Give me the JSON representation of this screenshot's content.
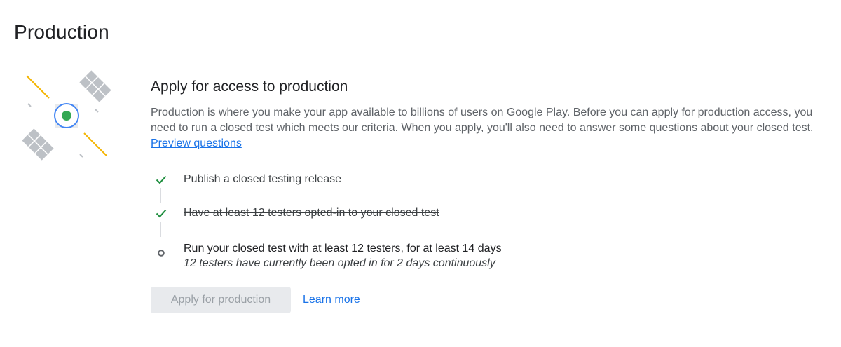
{
  "page": {
    "title": "Production"
  },
  "section": {
    "title": "Apply for access to production",
    "description": "Production is where you make your app available to billions of users on Google Play. Before you can apply for production access, you need to run a closed test which meets our criteria. When you apply, you'll also need to answer some questions about your closed test.",
    "preview_link": "Preview questions"
  },
  "checklist": [
    {
      "label": "Publish a closed testing release",
      "status": "done",
      "icon": "check-icon"
    },
    {
      "label": "Have at least 12 testers opted-in to your closed test",
      "status": "done",
      "icon": "check-icon"
    },
    {
      "label": "Run your closed test with at least 12 testers, for at least 14 days",
      "sublabel": "12 testers have currently been opted in for 2 days continuously",
      "status": "pending",
      "icon": "circle-icon"
    }
  ],
  "actions": {
    "apply_label": "Apply for production",
    "apply_disabled": true,
    "learn_more_label": "Learn more"
  },
  "colors": {
    "check": "#1e8e3e",
    "link": "#1a73e8",
    "satellite_ring": "#4285f4",
    "satellite_core": "#34a853",
    "satellite_panel": "#bdc1c6",
    "signal_line": "#f4b400"
  },
  "illustration": {
    "icon": "satellite-icon"
  }
}
